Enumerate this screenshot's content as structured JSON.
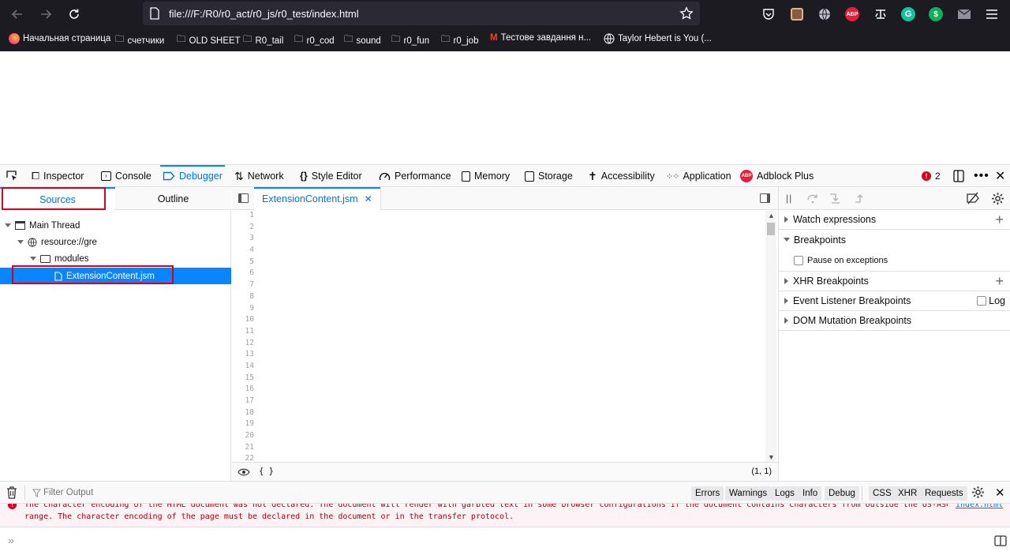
{
  "browser": {
    "url": "file:///F:/R0/r0_act/r0_js/r0_test/index.html",
    "bookmarks": [
      "Начальная страница",
      "счетчики",
      "OLD SHEET",
      "R0_tail",
      "r0_cod",
      "sound",
      "r0_fun",
      "r0_job",
      "Тестове завдання н...",
      "Taylor Hebert is You (..."
    ],
    "ext_badge": "ABP"
  },
  "devtools": {
    "tabs": [
      "Inspector",
      "Console",
      "Debugger",
      "Network",
      "Style Editor",
      "Performance",
      "Memory",
      "Storage",
      "Accessibility",
      "Application",
      "Adblock Plus"
    ],
    "selected_tab": "Debugger",
    "error_count": "2",
    "sources": {
      "tabs": [
        "Sources",
        "Outline"
      ],
      "tree": [
        "Main Thread",
        "resource://gre",
        "modules",
        "ExtensionContent.jsm"
      ]
    },
    "editor": {
      "tab": "ExtensionContent.jsm",
      "line_numbers": [
        "1",
        "2",
        "3",
        "4",
        "5",
        "6",
        "7",
        "8",
        "9",
        "10",
        "11",
        "12",
        "13",
        "14",
        "15",
        "16",
        "17",
        "18",
        "19",
        "20",
        "21",
        "22"
      ],
      "pretty_print": "{ }",
      "cursor": "(1, 1)"
    },
    "right_pane": {
      "watch": "Watch expressions",
      "breakpoints": "Breakpoints",
      "pause_exceptions": "Pause on exceptions",
      "xhr": "XHR Breakpoints",
      "event_listener": "Event Listener Breakpoints",
      "log": "Log",
      "dom_mutation": "DOM Mutation Breakpoints"
    },
    "console": {
      "filter_placeholder": "Filter Output",
      "filters": [
        "Errors",
        "Warnings",
        "Logs",
        "Info",
        "Debug",
        "CSS",
        "XHR",
        "Requests"
      ],
      "message_line1": "The character encoding of the HTML document was not declared. The document will render with garbled text in some browser configurations if the document contains characters from outside the US-ASCII",
      "message_line2": "range. The character encoding of the page must be declared in the document or in the transfer protocol.",
      "message_source": "index.html"
    }
  },
  "colors": {
    "chrome_bg": "#1c1b22",
    "accent": "#0a84ff",
    "highlight_box": "#d70022",
    "error_text": "#a4000f"
  }
}
